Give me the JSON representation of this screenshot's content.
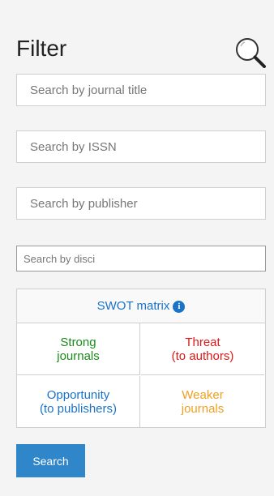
{
  "filter": {
    "title": "Filter",
    "search_icon": "search-icon"
  },
  "inputs": {
    "journal_title_placeholder": "Search by journal title",
    "issn_placeholder": "Search by ISSN",
    "publisher_placeholder": "Search by publisher",
    "discipline_placeholder": "Search by disci"
  },
  "swot": {
    "header": "SWOT matrix",
    "info_icon": "info-icon",
    "strong": [
      "Strong",
      "journals"
    ],
    "threat": [
      "Threat",
      "(to authors)"
    ],
    "opportunity": [
      "Opportunity",
      "(to publishers)"
    ],
    "weaker": [
      "Weaker",
      "journals"
    ]
  },
  "search_button": "Search",
  "colors": {
    "strong": "#1a8a1a",
    "threat": "#e01818",
    "opportunity": "#1a73c8",
    "weaker": "#f0a020",
    "button": "#2f86c8"
  }
}
